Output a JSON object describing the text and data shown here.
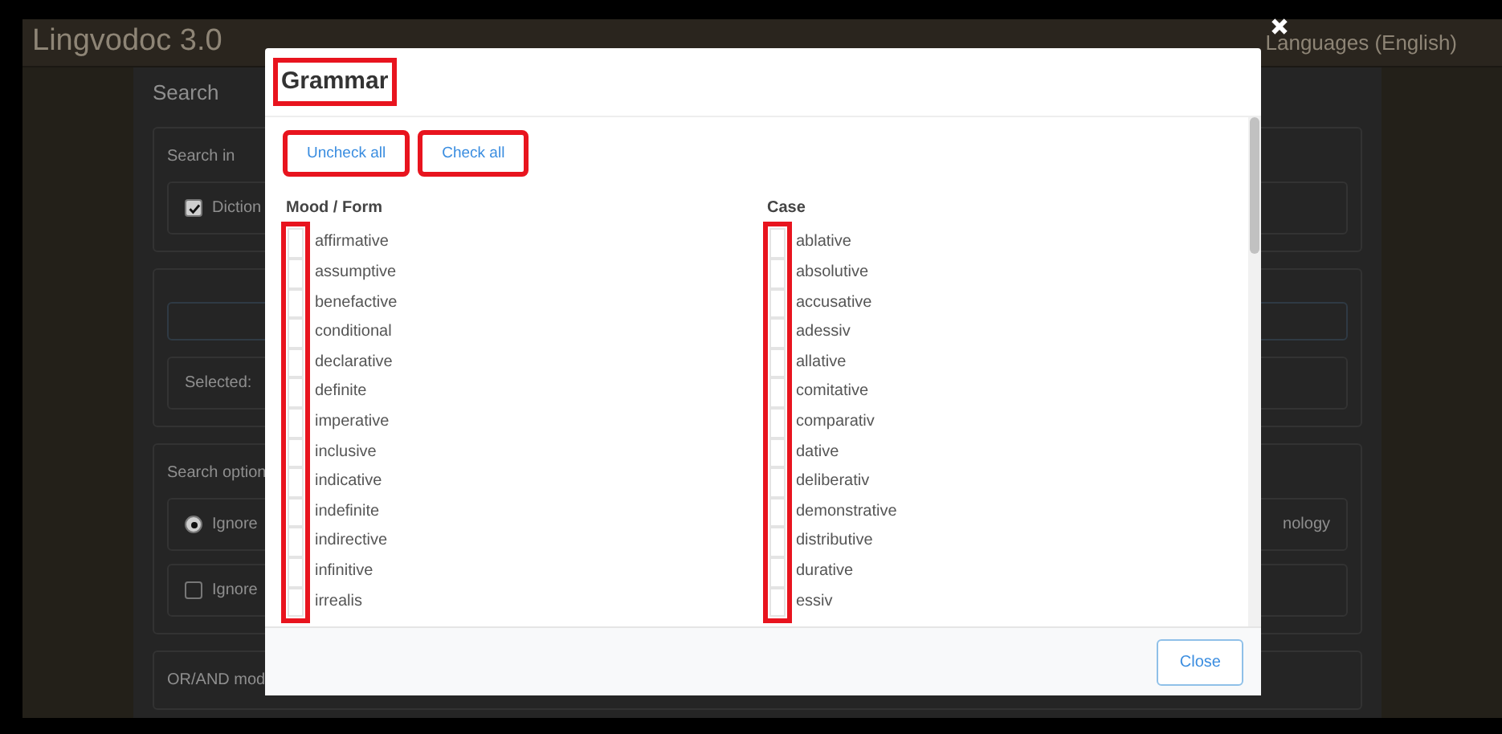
{
  "app": {
    "title": "Lingvodoc 3.0",
    "language_menu": "Languages (English)",
    "panel": {
      "title": "Search",
      "search_in_label": "Search in",
      "dictionaries_option": {
        "label": "Diction",
        "checked": true
      },
      "selected_label": "Selected:",
      "search_options_label": "Search option",
      "options": [
        {
          "kind": "radio",
          "label": "Ignore",
          "checked": true
        },
        {
          "kind": "checkbox",
          "label": "Ignore",
          "checked": false
        }
      ],
      "side_text": "nology",
      "mode_label": "OR/AND mod"
    }
  },
  "modal": {
    "title": "Grammar",
    "title_highlighted": true,
    "buttons": [
      {
        "label": "Uncheck all",
        "highlighted": true
      },
      {
        "label": "Check all",
        "highlighted": true
      }
    ],
    "groups": [
      {
        "title": "Mood / Form",
        "checkboxes_highlighted": true,
        "items": [
          {
            "label": "affirmative",
            "checked": false
          },
          {
            "label": "assumptive",
            "checked": false
          },
          {
            "label": "benefactive",
            "checked": false
          },
          {
            "label": "conditional",
            "checked": false
          },
          {
            "label": "declarative",
            "checked": false
          },
          {
            "label": "definite",
            "checked": false
          },
          {
            "label": "imperative",
            "checked": false
          },
          {
            "label": "inclusive",
            "checked": false
          },
          {
            "label": "indicative",
            "checked": false
          },
          {
            "label": "indefinite",
            "checked": false
          },
          {
            "label": "indirective",
            "checked": false
          },
          {
            "label": "infinitive",
            "checked": false
          },
          {
            "label": "irrealis",
            "checked": false
          }
        ]
      },
      {
        "title": "Case",
        "checkboxes_highlighted": true,
        "items": [
          {
            "label": "ablative",
            "checked": false
          },
          {
            "label": "absolutive",
            "checked": false
          },
          {
            "label": "accusative",
            "checked": false
          },
          {
            "label": "adessiv",
            "checked": false
          },
          {
            "label": "allative",
            "checked": false
          },
          {
            "label": "comitative",
            "checked": false
          },
          {
            "label": "comparativ",
            "checked": false
          },
          {
            "label": "dative",
            "checked": false
          },
          {
            "label": "deliberativ",
            "checked": false
          },
          {
            "label": "demonstrative",
            "checked": false
          },
          {
            "label": "distributive",
            "checked": false
          },
          {
            "label": "durative",
            "checked": false
          },
          {
            "label": "essiv",
            "checked": false
          }
        ]
      }
    ],
    "close_button": "Close"
  }
}
